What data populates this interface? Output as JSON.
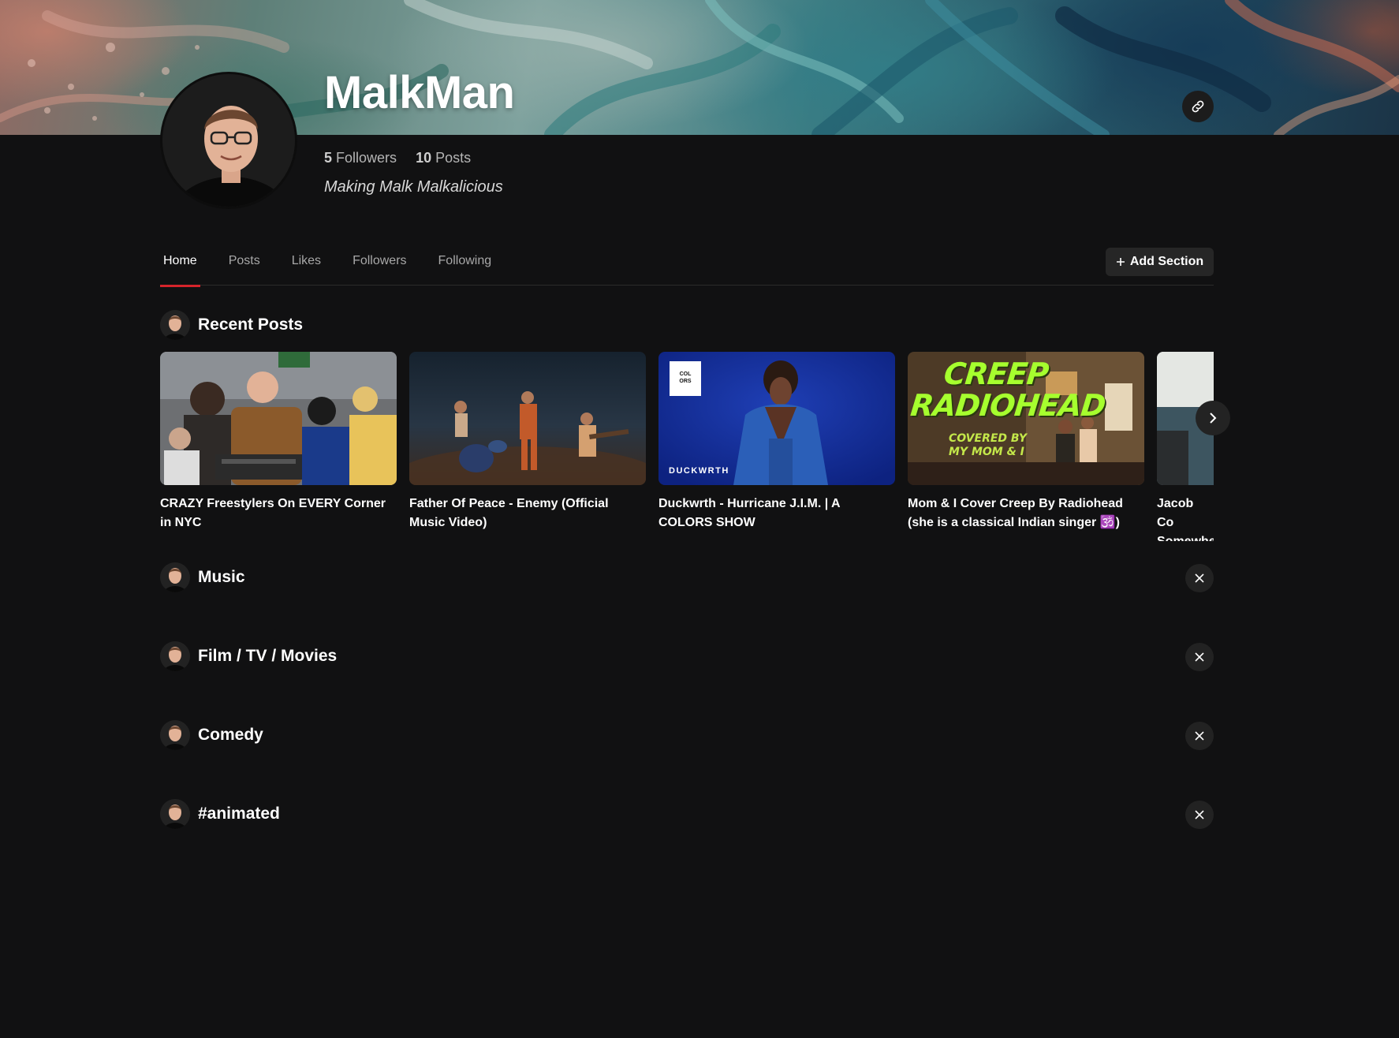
{
  "profile": {
    "username": "MalkMan",
    "followers_count": "5",
    "followers_label": "Followers",
    "posts_count": "10",
    "posts_label": "Posts",
    "bio": "Making Malk Malkalicious"
  },
  "tabs": [
    {
      "label": "Home"
    },
    {
      "label": "Posts"
    },
    {
      "label": "Likes"
    },
    {
      "label": "Followers"
    },
    {
      "label": "Following"
    }
  ],
  "add_section_label": "Add Section",
  "recent_posts": {
    "title": "Recent Posts",
    "posts": [
      {
        "title": "CRAZY Freestylers On EVERY Corner in NYC"
      },
      {
        "title": "Father Of Peace - Enemy (Official Music Video)"
      },
      {
        "title": "Duckwrth - Hurricane J.I.M. | A COLORS SHOW",
        "thumb_text": "DUCKWRTH",
        "logo_text": "COL ORS"
      },
      {
        "title": "Mom & I Cover Creep By Radiohead (she is a classical Indian singer 🕉️)",
        "thumb_line1": "CREEP",
        "thumb_line2": "RADIOHEAD",
        "thumb_sub": "COVERED BY MY MOM & I"
      },
      {
        "title": "Jacob Co Somewhe"
      }
    ]
  },
  "sections": [
    {
      "title": "Music"
    },
    {
      "title": "Film / TV / Movies"
    },
    {
      "title": "Comedy"
    },
    {
      "title": "#animated"
    }
  ],
  "colors": {
    "background": "#111112",
    "accent_tab_underline": "#d5242b",
    "button_bg": "#262626"
  },
  "icons": {
    "link": "link-icon",
    "add": "plus-icon",
    "close": "close-icon",
    "next": "chevron-right-icon"
  }
}
